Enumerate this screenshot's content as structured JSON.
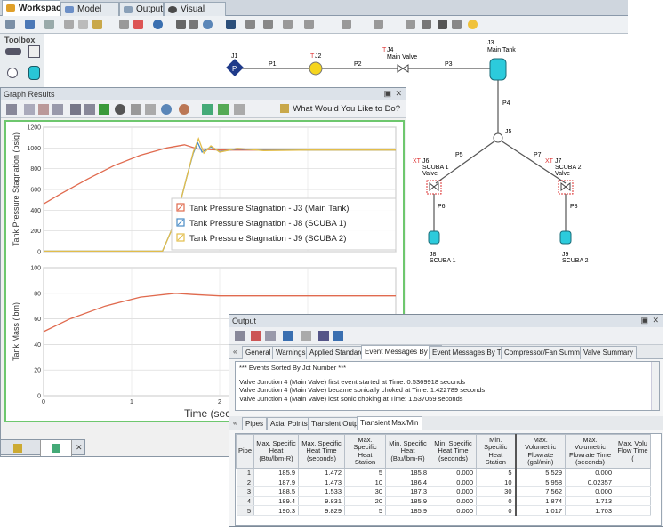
{
  "tabs": [
    {
      "label": "Workspace",
      "color": "#e0a02a"
    },
    {
      "label": "Model Data",
      "color": "#6c8fc7"
    },
    {
      "label": "Output",
      "color": "#8aa0b8"
    },
    {
      "label": "Visual Report",
      "color": "#4a4a4a"
    }
  ],
  "toolbox": {
    "title": "Toolbox"
  },
  "workspace": {
    "nodes": {
      "j1": "J1",
      "j2": "J2",
      "j4": "J4",
      "j4_label": "Main Valve",
      "j3": "J3",
      "j3_label": "Main Tank",
      "j5": "J5",
      "j6_tag": "XT",
      "j6": "J6",
      "j6_label1": "SCUBA 1",
      "j6_label2": "Valve",
      "j7_tag": "XT",
      "j7": "J7",
      "j7_label1": "SCUBA 2",
      "j7_label2": "Valve",
      "j8": "J8",
      "j8_label": "SCUBA 1",
      "j9": "J9",
      "j9_label": "SCUBA 2",
      "t_j2": "T",
      "t_j4": "T"
    },
    "pipes": {
      "p1": "P1",
      "p2": "P2",
      "p3": "P3",
      "p4": "P4",
      "p5": "P5",
      "p6": "P6",
      "p7": "P7",
      "p8": "P8"
    }
  },
  "graph": {
    "title": "Graph Results",
    "what_label": "What Would You Like to Do?",
    "footer_tabs": [
      "",
      ""
    ]
  },
  "chart_data": [
    {
      "type": "line",
      "ylabel": "Tank Pressure Stagnation (psig)",
      "xlim": [
        0,
        4
      ],
      "ylim": [
        0,
        1200
      ],
      "yticks": [
        0,
        200,
        400,
        600,
        800,
        1000,
        1200
      ],
      "legend": "right",
      "series": [
        {
          "name": "Tank Pressure Stagnation - J3 (Main Tank)",
          "color": "#e06a4e",
          "x": [
            0,
            0.2,
            0.5,
            0.8,
            1.1,
            1.4,
            1.6,
            1.75,
            2.0,
            2.5,
            3.0,
            4.0
          ],
          "y": [
            460,
            560,
            700,
            830,
            930,
            1000,
            1030,
            990,
            980,
            980,
            980,
            980
          ]
        },
        {
          "name": "Tank Pressure Stagnation - J8 (SCUBA 1)",
          "color": "#4a8cc6",
          "x": [
            0,
            1.35,
            1.5,
            1.62,
            1.7,
            1.75,
            1.8,
            1.9,
            2.0,
            2.2,
            2.5,
            3.0,
            4.0
          ],
          "y": [
            5,
            5,
            300,
            700,
            950,
            1050,
            960,
            1010,
            965,
            990,
            978,
            980,
            980
          ]
        },
        {
          "name": "Tank Pressure Stagnation - J9 (SCUBA 2)",
          "color": "#e2bd4a",
          "x": [
            0,
            1.35,
            1.5,
            1.62,
            1.7,
            1.76,
            1.82,
            1.9,
            2.0,
            2.2,
            2.5,
            3.0,
            4.0
          ],
          "y": [
            5,
            5,
            300,
            700,
            960,
            1090,
            950,
            1020,
            960,
            995,
            975,
            980,
            980
          ]
        }
      ]
    },
    {
      "type": "line",
      "xlabel": "Time (sec",
      "ylabel": "Tank Mass (lbm)",
      "xlim": [
        0,
        4
      ],
      "ylim": [
        0,
        100
      ],
      "yticks": [
        0,
        20,
        40,
        60,
        80,
        100
      ],
      "xticks": [
        0,
        1,
        2
      ],
      "series": [
        {
          "name": "",
          "color": "#e06a4e",
          "x": [
            0,
            0.3,
            0.7,
            1.1,
            1.5,
            1.7,
            2.0,
            4.0
          ],
          "y": [
            50,
            60,
            70,
            77,
            80,
            79,
            78,
            78
          ]
        }
      ]
    }
  ],
  "output": {
    "title": "Output",
    "tabs1": [
      "General",
      "Warnings",
      "Applied Standards",
      "Event Messages By Jct",
      "Event Messages By Time",
      "Compressor/Fan Summary",
      "Valve Summary"
    ],
    "messages": [
      "*** Events Sorted By Jct Number ***",
      "",
      "Valve Junction 4 (Main Valve) first event started at Time: 0.5369918 seconds",
      "Valve Junction 4 (Main Valve) became sonically choked at Time: 1.422789 seconds",
      "Valve Junction 4 (Main Valve) lost sonic choking at Time: 1.537059 seconds"
    ],
    "tabs2": [
      "Pipes",
      "Axial Points",
      "Transient Output",
      "Transient Max/Min"
    ],
    "table": {
      "headers": [
        "Pipe",
        "Max. Specific Heat (Btu/lbm-R)",
        "Max. Specific Heat Time (seconds)",
        "Max. Specific Heat Station",
        "Min. Specific Heat (Btu/lbm-R)",
        "Min. Specific Heat Time (seconds)",
        "Min. Specific Heat Station",
        "Max. Volumetric Flowrate (gal/min)",
        "Max. Volumetric Flowrate Time (seconds)",
        "Max. Volu Flow Time ("
      ],
      "rows": [
        [
          "1",
          "185.9",
          "1.472",
          "5",
          "185.8",
          "0.000",
          "5",
          "5,529",
          "0.000",
          ""
        ],
        [
          "2",
          "187.9",
          "1.473",
          "10",
          "186.4",
          "0.000",
          "10",
          "5,958",
          "0.02357",
          ""
        ],
        [
          "3",
          "188.5",
          "1.533",
          "30",
          "187.3",
          "0.000",
          "30",
          "7,562",
          "0.000",
          ""
        ],
        [
          "4",
          "189.4",
          "9.831",
          "20",
          "185.9",
          "0.000",
          "0",
          "1,874",
          "1.713",
          ""
        ],
        [
          "5",
          "190.3",
          "9.829",
          "5",
          "185.9",
          "0.000",
          "0",
          "1,017",
          "1.703",
          ""
        ]
      ]
    }
  }
}
